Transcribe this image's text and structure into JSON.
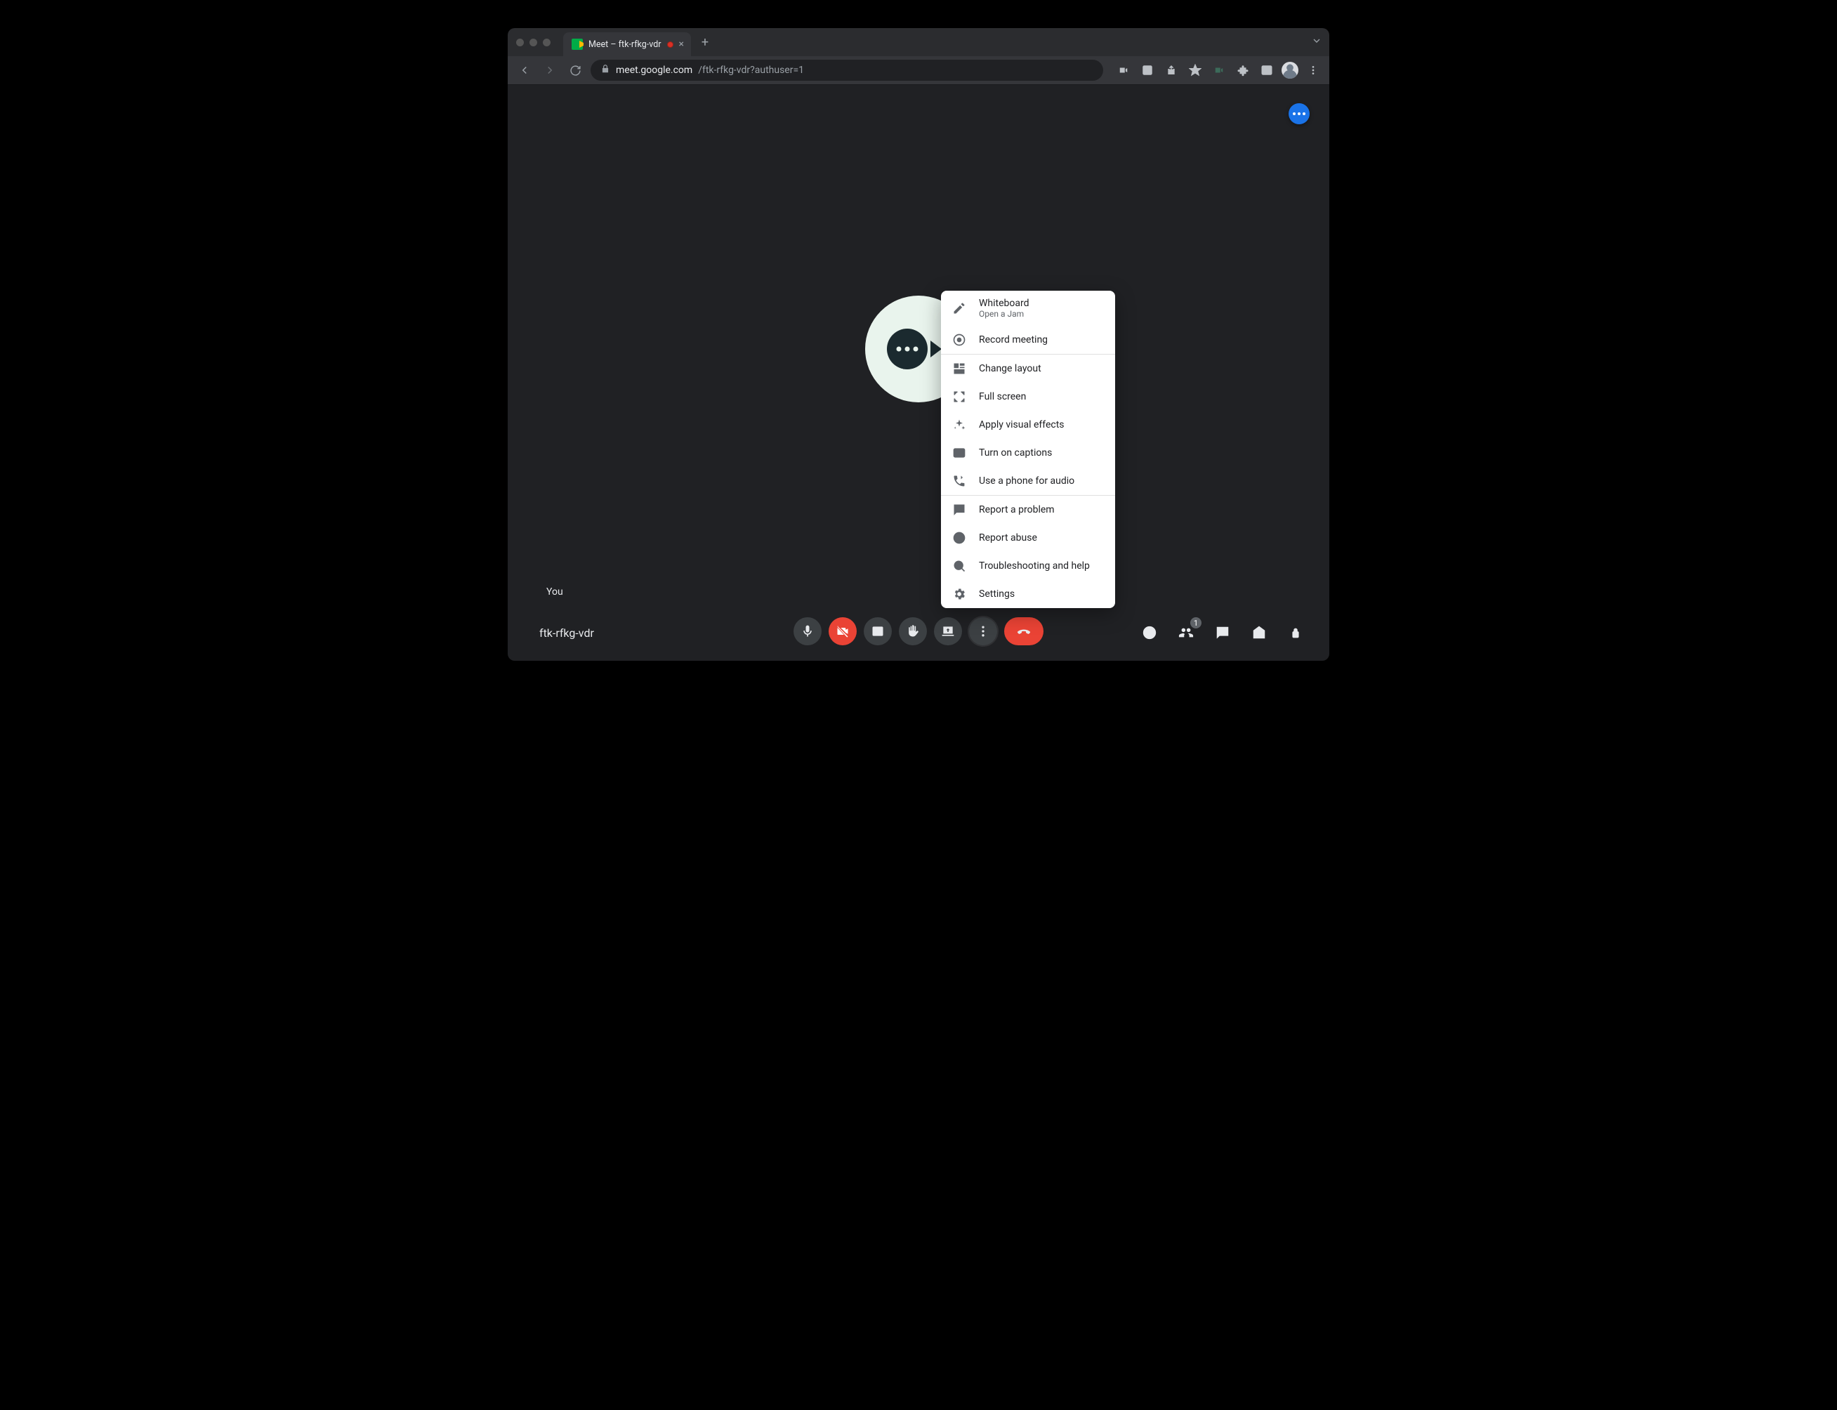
{
  "browser": {
    "tab_title": "Meet – ftk-rfkg-vdr",
    "url_host": "meet.google.com",
    "url_path": "/ftk-rfkg-vdr?authuser=1"
  },
  "meet": {
    "self_label": "You",
    "meeting_id": "ftk-rfkg-vdr",
    "participant_badge": "1"
  },
  "menu": {
    "whiteboard_label": "Whiteboard",
    "whiteboard_sub": "Open a Jam",
    "record_label": "Record meeting",
    "layout_label": "Change layout",
    "fullscreen_label": "Full screen",
    "effects_label": "Apply visual effects",
    "captions_label": "Turn on captions",
    "phone_audio_label": "Use a phone for audio",
    "report_problem_label": "Report a problem",
    "report_abuse_label": "Report abuse",
    "troubleshoot_label": "Troubleshooting and help",
    "settings_label": "Settings"
  }
}
